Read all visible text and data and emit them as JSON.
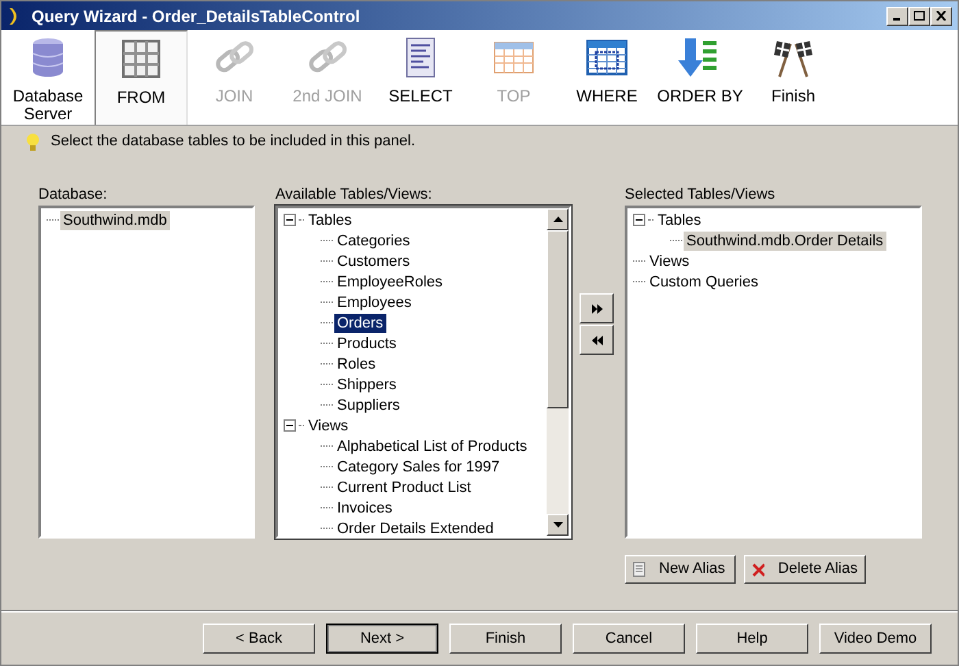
{
  "window": {
    "title": "Query Wizard - Order_DetailsTableControl"
  },
  "steps": [
    {
      "label": "Database Server",
      "selected": false,
      "disabled": false
    },
    {
      "label": "FROM",
      "selected": true,
      "disabled": false
    },
    {
      "label": "JOIN",
      "selected": false,
      "disabled": true
    },
    {
      "label": "2nd JOIN",
      "selected": false,
      "disabled": true
    },
    {
      "label": "SELECT",
      "selected": false,
      "disabled": false
    },
    {
      "label": "TOP",
      "selected": false,
      "disabled": true
    },
    {
      "label": "WHERE",
      "selected": false,
      "disabled": false
    },
    {
      "label": "ORDER BY",
      "selected": false,
      "disabled": false
    },
    {
      "label": "Finish",
      "selected": false,
      "disabled": false
    }
  ],
  "hint": "Select the database tables to be included in this panel.",
  "database": {
    "label": "Database:",
    "focused": false,
    "items": [
      {
        "label": "Southwind.mdb",
        "selected": true
      }
    ]
  },
  "available": {
    "label": "Available Tables/Views:",
    "focused": true,
    "items": [
      {
        "label": "Tables",
        "selected": false,
        "expanded": true,
        "children": [
          {
            "label": "Categories",
            "selected": false
          },
          {
            "label": "Customers",
            "selected": false
          },
          {
            "label": "EmployeeRoles",
            "selected": false
          },
          {
            "label": "Employees",
            "selected": false
          },
          {
            "label": "Orders",
            "selected": true
          },
          {
            "label": "Products",
            "selected": false
          },
          {
            "label": "Roles",
            "selected": false
          },
          {
            "label": "Shippers",
            "selected": false
          },
          {
            "label": "Suppliers",
            "selected": false
          }
        ]
      },
      {
        "label": "Views",
        "selected": false,
        "expanded": true,
        "children": [
          {
            "label": "Alphabetical List of Products",
            "selected": false
          },
          {
            "label": "Category Sales for 1997",
            "selected": false
          },
          {
            "label": "Current Product List",
            "selected": false
          },
          {
            "label": "Invoices",
            "selected": false
          },
          {
            "label": "Order Details Extended",
            "selected": false
          }
        ]
      }
    ]
  },
  "selected_tables": {
    "label": "Selected Tables/Views",
    "focused": false,
    "items": [
      {
        "label": "Tables",
        "selected": false,
        "expanded": true,
        "children": [
          {
            "label": "Southwind.mdb.Order Details",
            "selected": true
          }
        ]
      },
      {
        "label": "Views",
        "selected": false
      },
      {
        "label": "Custom Queries",
        "selected": false
      }
    ]
  },
  "alias_buttons": [
    {
      "label": "New Alias"
    },
    {
      "label": "Delete Alias"
    }
  ],
  "buttons": [
    {
      "label": "< Back",
      "default": false
    },
    {
      "label": "Next >",
      "default": true
    },
    {
      "label": "Finish",
      "default": false
    },
    {
      "label": "Cancel",
      "default": false
    },
    {
      "label": "Help",
      "default": false
    },
    {
      "label": "Video Demo",
      "default": false
    }
  ]
}
